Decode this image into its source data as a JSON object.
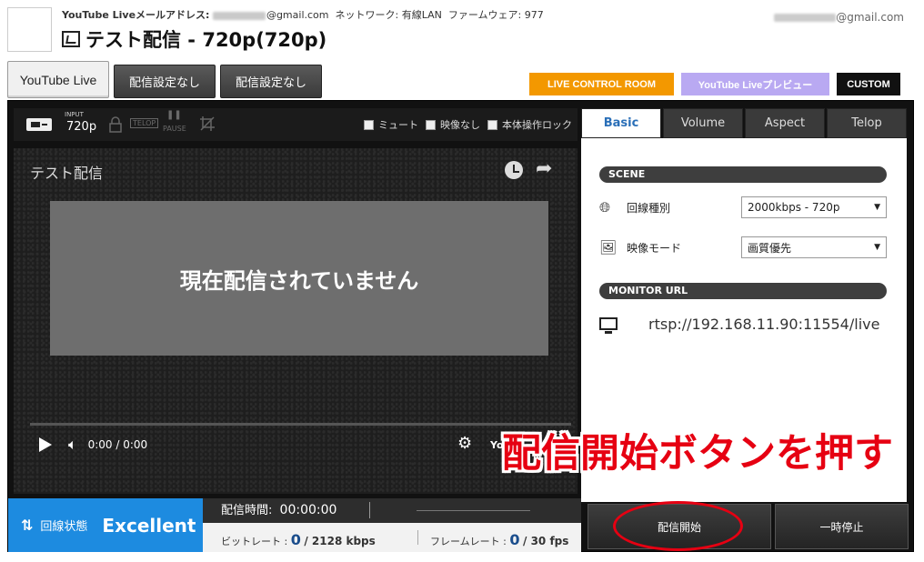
{
  "header": {
    "email_label": "YouTube Liveメールアドレス:",
    "email_domain": "@gmail.com",
    "network_label": "ネットワーク:",
    "network_value": "有線LAN",
    "firmware_label": "ファームウェア:",
    "firmware_value": "977",
    "account_domain": "@gmail.com",
    "title": "テスト配信 - 720p(720p)"
  },
  "top_buttons": {
    "youtube_live": "YouTube Live",
    "preset_1": "配信設定なし",
    "preset_2": "配信設定なし",
    "live_control_room": "LIVE CONTROL ROOM",
    "youtube_preview": "YouTube Liveプレビュー",
    "custom": "CUSTOM"
  },
  "video_toolbar": {
    "input_label": "INPUT",
    "resolution": "720p",
    "telop": "TELOP",
    "pause": "PAUSE",
    "mute": "ミュート",
    "no_video": "映像なし",
    "lock": "本体操作ロック"
  },
  "player": {
    "title": "テスト配信",
    "message": "現在配信されていません",
    "time": "0:00 / 0:00",
    "logo": "You"
  },
  "tabs": [
    "Basic",
    "Volume",
    "Aspect",
    "Telop"
  ],
  "scene": {
    "heading": "SCENE",
    "line_type_label": "回線種別",
    "line_type_value": "2000kbps - 720p",
    "video_mode_label": "映像モード",
    "video_mode_value": "画質優先"
  },
  "monitor": {
    "heading": "MONITOR URL",
    "url": "rtsp://192.168.11.90:11554/live"
  },
  "status": {
    "line_label": "回線状態",
    "line_value": "Excellent",
    "duration_label": "配信時間:",
    "duration_value": "00:00:00",
    "bitrate_label": "ビットレート :",
    "bitrate_value": "0",
    "bitrate_total": "/ 2128 kbps",
    "framerate_label": "フレームレート :",
    "framerate_value": "0",
    "framerate_total": "/ 30 fps"
  },
  "actions": {
    "start": "配信開始",
    "pause": "一時停止"
  },
  "annotation": {
    "text": "配信開始ボタンを押す"
  },
  "colors": {
    "orange": "#f39800",
    "lavender": "#b9a9f2",
    "status_blue": "#1d8be0",
    "annotation_red": "#e60012"
  }
}
